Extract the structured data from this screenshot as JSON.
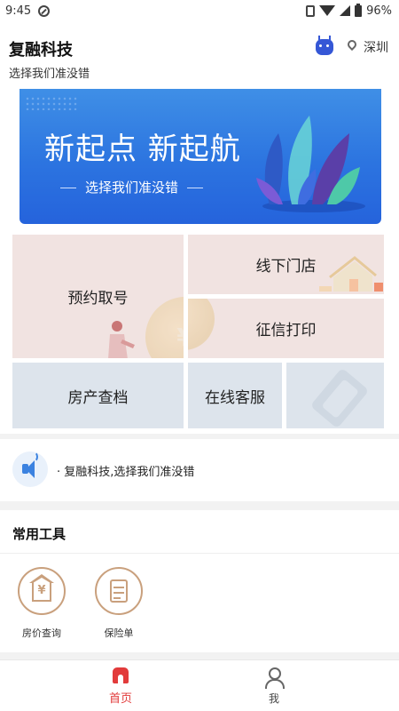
{
  "status_bar": {
    "time": "9:45",
    "battery": "96%"
  },
  "header": {
    "title": "复融科技",
    "subtitle": "选择我们准没错",
    "location": "深圳"
  },
  "banner": {
    "headline": "新起点 新起航",
    "tagline": "选择我们准没错"
  },
  "grid": {
    "appointment": "预约取号",
    "offline_store": "线下门店",
    "credit_print": "征信打印",
    "property_check": "房产查档",
    "online_service": "在线客服"
  },
  "notice": {
    "text": "· 复融科技,选择我们准没错"
  },
  "tools": {
    "heading": "常用工具",
    "items": [
      {
        "label": "房价查询",
        "icon": "house-price-icon"
      },
      {
        "label": "保险单",
        "icon": "insurance-doc-icon"
      }
    ]
  },
  "tabbar": {
    "items": [
      {
        "label": "首页",
        "icon": "home-icon",
        "active": true
      },
      {
        "label": "我",
        "icon": "user-icon",
        "active": false
      }
    ]
  },
  "colors": {
    "accent": "#e23b3b",
    "banner_blue": "#2c74e0",
    "tool_gold": "#c9a07d",
    "card_pink": "#f1e3e1",
    "card_blue": "#dde4ec"
  }
}
